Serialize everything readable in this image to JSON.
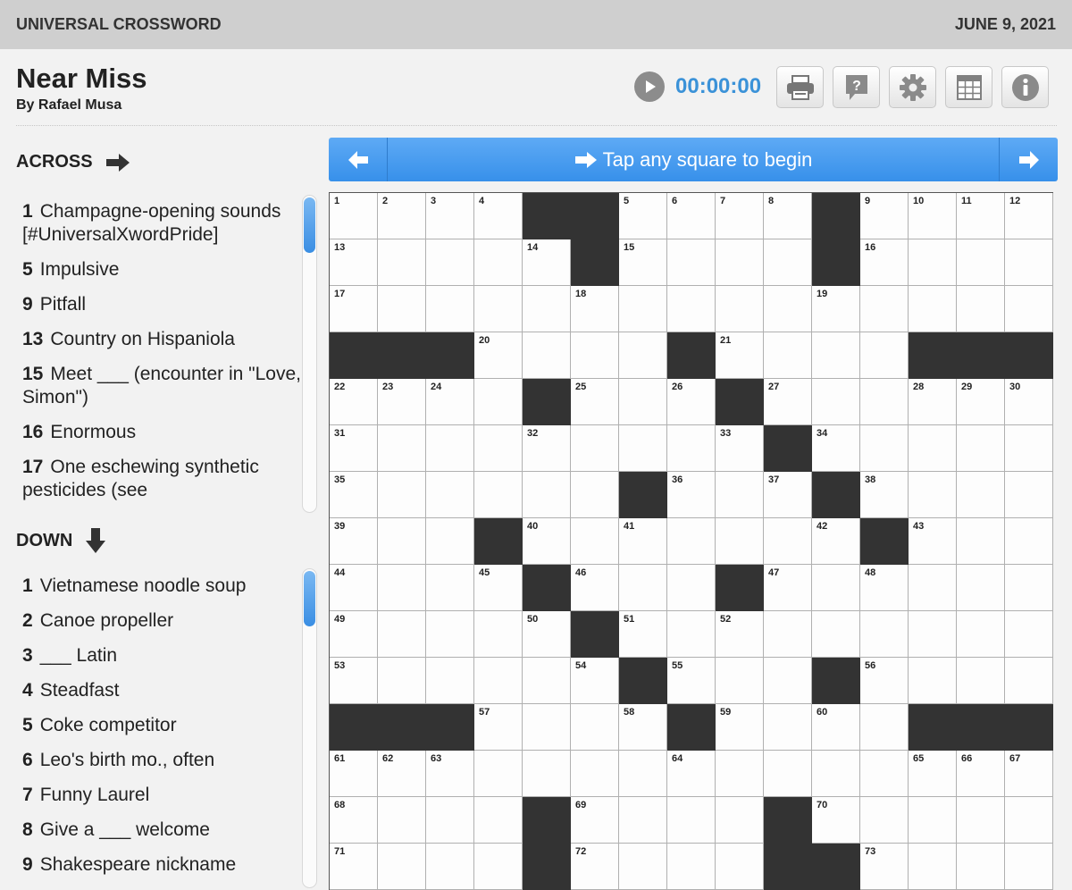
{
  "header": {
    "publisher": "UNIVERSAL CROSSWORD",
    "date": "JUNE 9, 2021"
  },
  "puzzle": {
    "title": "Near Miss",
    "byline": "By Rafael Musa"
  },
  "toolbar": {
    "timer": "00:00:00",
    "play_icon": "play-icon",
    "buttons": [
      "print-icon",
      "help-icon",
      "settings-icon",
      "grid-icon",
      "info-icon"
    ]
  },
  "clue_bar": {
    "text": "Tap any square to begin"
  },
  "across": {
    "heading": "ACROSS",
    "clues": [
      {
        "num": "1",
        "text": "Champagne-opening sounds [#UniversalXwordPride]"
      },
      {
        "num": "5",
        "text": "Impulsive"
      },
      {
        "num": "9",
        "text": "Pitfall"
      },
      {
        "num": "13",
        "text": "Country on Hispaniola"
      },
      {
        "num": "15",
        "text": "Meet ___ (encounter in \"Love, Simon\")"
      },
      {
        "num": "16",
        "text": "Enormous"
      },
      {
        "num": "17",
        "text": "One eschewing synthetic pesticides (see"
      }
    ]
  },
  "down": {
    "heading": "DOWN",
    "clues": [
      {
        "num": "1",
        "text": "Vietnamese noodle soup"
      },
      {
        "num": "2",
        "text": "Canoe propeller"
      },
      {
        "num": "3",
        "text": "___ Latin"
      },
      {
        "num": "4",
        "text": "Steadfast"
      },
      {
        "num": "5",
        "text": "Coke competitor"
      },
      {
        "num": "6",
        "text": "Leo's birth mo., often"
      },
      {
        "num": "7",
        "text": "Funny Laurel"
      },
      {
        "num": "8",
        "text": "Give a ___ welcome"
      },
      {
        "num": "9",
        "text": "Shakespeare nickname"
      }
    ]
  },
  "grid": {
    "rows": [
      "....##...#....",
      ".....#....#....",
      "...............",
      "###....#.....###",
      "....#..#.......",
      "........#......",
      "......#...#....",
      "....#......#...",
      ".....#...#.....",
      "......#........",
      ".......#..#....",
      "###....#.....###",
      "...............",
      ".....#...#.....",
      ".....#...##...."
    ],
    "numbers": [
      [
        1,
        2,
        3,
        4,
        0,
        0,
        5,
        6,
        7,
        8,
        0,
        9,
        10,
        11,
        12
      ],
      [
        13,
        0,
        0,
        0,
        14,
        0,
        15,
        0,
        0,
        0,
        0,
        16,
        0,
        0,
        0
      ],
      [
        17,
        0,
        0,
        0,
        0,
        18,
        0,
        0,
        0,
        0,
        19,
        0,
        0,
        0,
        0
      ],
      [
        0,
        0,
        0,
        20,
        0,
        0,
        0,
        0,
        21,
        0,
        0,
        0,
        0,
        0,
        0
      ],
      [
        22,
        23,
        24,
        0,
        0,
        25,
        0,
        26,
        0,
        27,
        0,
        0,
        28,
        29,
        30
      ],
      [
        31,
        0,
        0,
        0,
        32,
        0,
        0,
        0,
        33,
        0,
        34,
        0,
        0,
        0,
        0
      ],
      [
        35,
        0,
        0,
        0,
        0,
        0,
        0,
        36,
        0,
        37,
        0,
        38,
        0,
        0,
        0
      ],
      [
        39,
        0,
        0,
        0,
        40,
        0,
        41,
        0,
        0,
        0,
        42,
        0,
        43,
        0,
        0
      ],
      [
        44,
        0,
        0,
        45,
        0,
        46,
        0,
        0,
        0,
        47,
        0,
        48,
        0,
        0,
        0
      ],
      [
        49,
        0,
        0,
        0,
        50,
        0,
        51,
        0,
        52,
        0,
        0,
        0,
        0,
        0,
        0
      ],
      [
        53,
        0,
        0,
        0,
        0,
        54,
        0,
        55,
        0,
        0,
        0,
        56,
        0,
        0,
        0
      ],
      [
        0,
        0,
        0,
        57,
        0,
        0,
        58,
        0,
        59,
        0,
        60,
        0,
        0,
        0,
        0
      ],
      [
        61,
        62,
        63,
        0,
        0,
        0,
        0,
        64,
        0,
        0,
        0,
        0,
        65,
        66,
        67
      ],
      [
        68,
        0,
        0,
        0,
        0,
        69,
        0,
        0,
        0,
        0,
        70,
        0,
        0,
        0,
        0
      ],
      [
        71,
        0,
        0,
        0,
        0,
        72,
        0,
        0,
        0,
        0,
        0,
        73,
        0,
        0,
        0
      ]
    ]
  }
}
